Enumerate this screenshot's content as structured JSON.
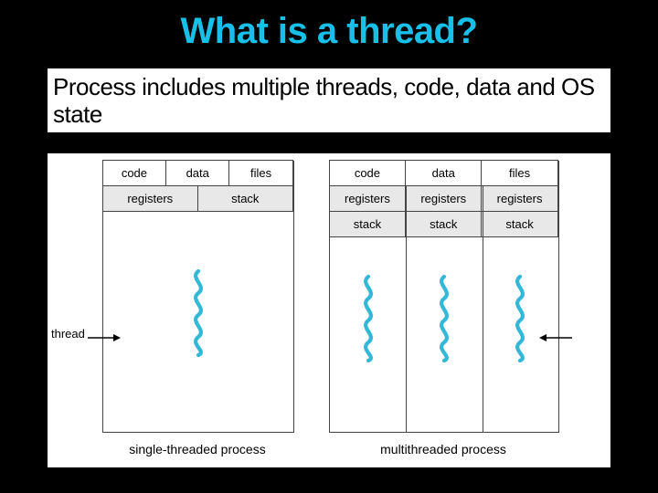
{
  "title": "What is a thread?",
  "subtitle": "Process includes multiple threads, code, data and OS state",
  "labels": {
    "code": "code",
    "data": "data",
    "files": "files",
    "registers": "registers",
    "stack": "stack",
    "thread": "thread"
  },
  "captions": {
    "single": "single-threaded process",
    "multi": "multithreaded process"
  }
}
